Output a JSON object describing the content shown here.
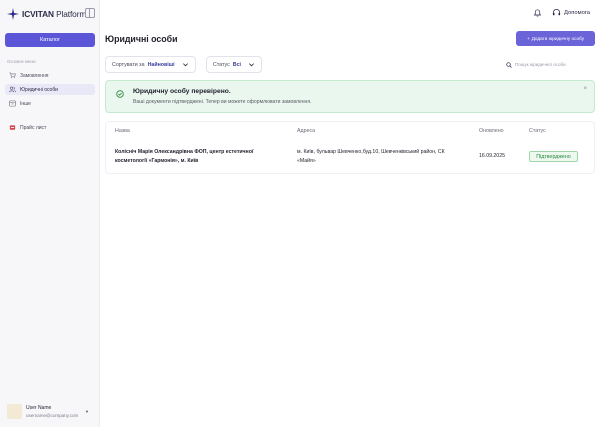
{
  "app": {
    "brand_bold": "ICVITAN",
    "brand_rest": " Platform"
  },
  "sidebar": {
    "catalog_label": "Каталог",
    "section_label": "Основне меню",
    "items": [
      {
        "label": "Замовлення",
        "icon": "cart-icon"
      },
      {
        "label": "Юридичні особи",
        "icon": "users-icon",
        "active": true
      },
      {
        "label": "Інше",
        "icon": "archive-icon"
      },
      {
        "label": "Прайс лист",
        "icon": "pdf-file-icon"
      }
    ],
    "user": {
      "name": "User Name",
      "email": "username@company.com"
    }
  },
  "topbar": {
    "help_label": "Допомога"
  },
  "page": {
    "title": "Юридичні особи",
    "add_button_label": "Додати юридичну особу",
    "sort": {
      "label": "Сортувати за",
      "value": "Найновіші"
    },
    "status_filter": {
      "label": "Статус",
      "value": "Всі"
    },
    "search_placeholder": "Пошук юридичної особи"
  },
  "alert": {
    "title": "Юридичну особу перевірено.",
    "text": "Ваші документи підтверджені. Тепер ви можете оформлювати замовлення."
  },
  "table": {
    "columns": [
      "Назва",
      "Адреса",
      "Оновлено",
      "Статус"
    ],
    "rows": [
      {
        "name_line1": "Колісніч Марія Олександрівна ФОП, центр естетичної",
        "name_line2": "косметології «Гармонія», м. Київ",
        "address_line1": "м. Київ, бульвар Шевченко,буд.10, Шевченківський район, СК",
        "address_line2": "«Майя»",
        "updated": "16.09.2025",
        "status": "Підтверджено"
      }
    ]
  },
  "colors": {
    "accent": "#5b56d8",
    "success_bg": "#eaf7ee",
    "success_text": "#2f8a41"
  }
}
